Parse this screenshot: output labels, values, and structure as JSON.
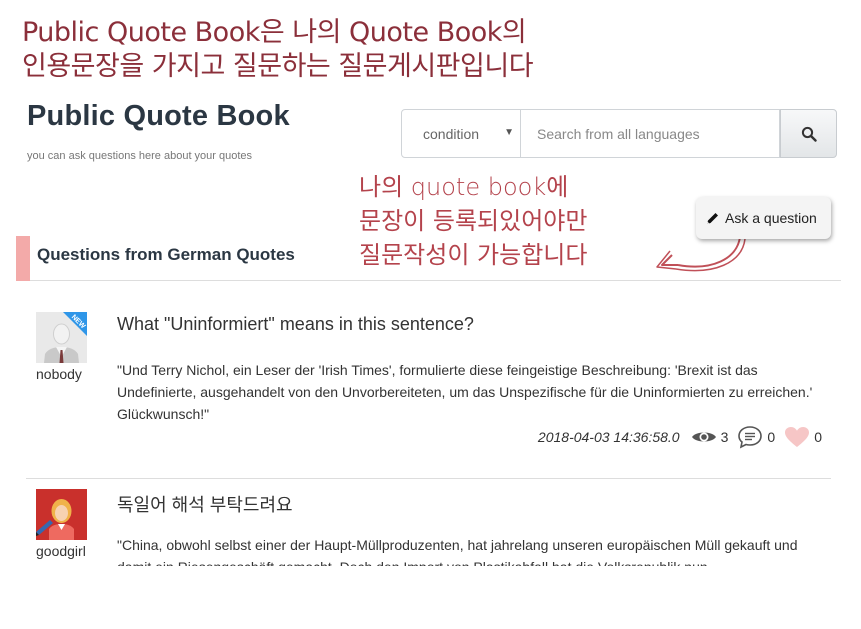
{
  "annotation_top": {
    "line1": "Public Quote Book은 나의 Quote Book의",
    "line2": "인용문장을 가지고 질문하는 질문게시판입니다"
  },
  "brand": {
    "title": "Public Quote Book",
    "subtitle": "you can ask questions here about your quotes"
  },
  "search": {
    "condition_label": "condition",
    "placeholder": "Search from all languages",
    "button_icon": "search-icon"
  },
  "annotation_mid": {
    "line1": "나의 quote book에",
    "line2": "문장이 등록되있어야만",
    "line3": "질문작성이 가능합니다"
  },
  "ask_button": {
    "label": "Ask a question",
    "icon": "pencil-icon"
  },
  "section": {
    "title": "Questions from German Quotes",
    "accent_color": "#f3aaa9"
  },
  "questions": [
    {
      "user": "nobody",
      "avatar_icon": "default-user-avatar",
      "badge": "NEW",
      "title": "What \"Uninformiert\" means in this sentence?",
      "body": "\"Und Terry Nichol, ein Leser der 'Irish Times', formulierte diese feingeistige Beschreibung: 'Brexit ist das Undefinierte, ausgehandelt von den Unvorbereiteten, um das Unspezifische für die Uninformierten zu erreichen.' Glückwunsch!\"",
      "date": "2018-04-03 14:36:58.0",
      "views": "3",
      "comments": "0",
      "likes": "0"
    },
    {
      "user": "goodgirl",
      "avatar_icon": "girl-avatar",
      "title": "독일어 해석 부탁드려요",
      "body": "\"China, obwohl selbst einer der Haupt-Müllproduzenten, hat jahrelang unseren europäischen Müll gekauft und damit ein Riesengeschäft gemacht. Doch den Import von Plastikabfall hat die Volksrepublik nun"
    }
  ]
}
